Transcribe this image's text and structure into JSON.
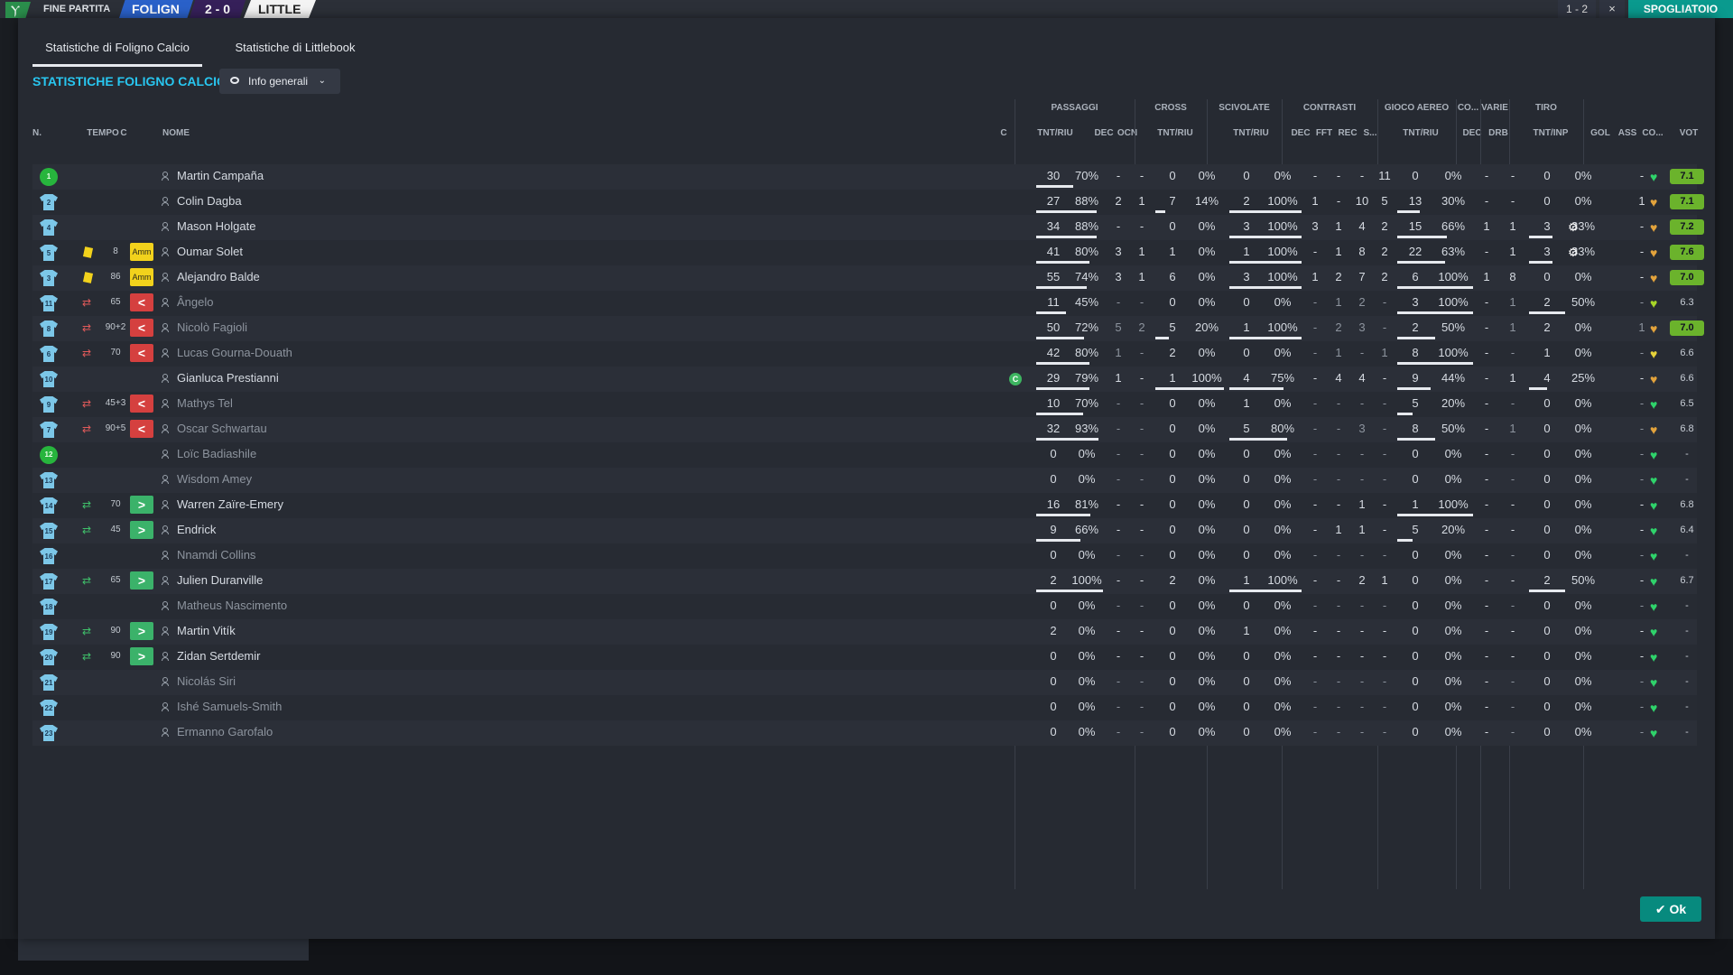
{
  "topbar": {
    "logo": "Ⲩ",
    "status": "FINE PARTITA",
    "home": "FOLIGN",
    "score": "2 - 0",
    "away": "LITTLE",
    "btn_score": "1 - 2",
    "btn_close": "×",
    "btn_right": "SPOGLIATOIO"
  },
  "tabs": [
    "Statistiche di Foligno Calcio",
    "Statistiche di Littlebook"
  ],
  "team_title": "STATISTICHE FOLIGNO CALCIO",
  "dropdown": "Info generali",
  "groups": {
    "passaggi": "PASSAGGI",
    "cross": "CROSS",
    "scivolate": "SCIVOLATE",
    "contrasti": "CONTRASTI",
    "aereo": "GIOCO AEREO",
    "co": "CO...",
    "varie": "VARIE",
    "tiro": "TIRO"
  },
  "headers": {
    "n": "N.",
    "tempo": "TEMPO",
    "c": "C",
    "nome": "NOME",
    "c2": "C",
    "pass_tr": "TNT/RIU",
    "pass_dec": "DEC",
    "pass_ocn": "OCN",
    "cross_tr": "TNT/RIU",
    "sciv_tr": "TNT/RIU",
    "con_dec": "DEC",
    "con_fft": "FFT",
    "con_rec": "REC",
    "con_s": "S...",
    "aer_tr": "TNT/RIU",
    "co_dec": "DEC",
    "var_drb": "DRB",
    "tiro_tr": "TNT/INP",
    "gol": "GOL",
    "ass": "ASS",
    "cond": "CO...",
    "vot": "VOT"
  },
  "colors": {
    "accent": "#28c6f0",
    "ok": "#078a7e",
    "heart_green": "#2fd36b",
    "heart_orange": "#e3a33c",
    "heart_lime": "#a8d628"
  },
  "players": [
    {
      "n": "1",
      "gk": true,
      "card": false,
      "swap": "",
      "min": "",
      "chip": "",
      "name": "Martin Campaña",
      "dim": false,
      "cap": false,
      "p": [
        "30",
        "70%",
        "-",
        "-"
      ],
      "cr": [
        "0",
        "0%"
      ],
      "sc": [
        "0",
        "0%"
      ],
      "ct": [
        "-",
        "-",
        "-",
        "11"
      ],
      "ae": [
        "0",
        "0%"
      ],
      "cd": "-",
      "drb": "-",
      "ti": [
        "0",
        "0%"
      ],
      "gol": "",
      "ass": "-",
      "heart": "green",
      "vot": "7.1",
      "vg": true,
      "bars": {
        "p": 0.55,
        "cr": 0,
        "sc": 0,
        "ae": 0,
        "ti": 0
      }
    },
    {
      "n": "2",
      "gk": false,
      "card": false,
      "swap": "",
      "min": "",
      "chip": "",
      "name": "Colin Dagba",
      "dim": false,
      "cap": false,
      "p": [
        "27",
        "88%",
        "2",
        "1"
      ],
      "cr": [
        "7",
        "14%"
      ],
      "sc": [
        "2",
        "100%"
      ],
      "ct": [
        "1",
        "-",
        "10",
        "5"
      ],
      "ae": [
        "13",
        "30%"
      ],
      "cd": "-",
      "drb": "-",
      "ti": [
        "0",
        "0%"
      ],
      "gol": "",
      "ass": "1",
      "heart": "orange",
      "vot": "7.1",
      "vg": true,
      "bars": {
        "p": 0.9,
        "cr": 0.15,
        "sc": 1,
        "ae": 0.3,
        "ti": 0
      }
    },
    {
      "n": "4",
      "gk": false,
      "card": false,
      "swap": "",
      "min": "",
      "chip": "",
      "name": "Mason Holgate",
      "dim": false,
      "cap": false,
      "p": [
        "34",
        "88%",
        "-",
        "-"
      ],
      "cr": [
        "0",
        "0%"
      ],
      "sc": [
        "3",
        "100%"
      ],
      "ct": [
        "3",
        "1",
        "4",
        "2"
      ],
      "ae": [
        "15",
        "66%"
      ],
      "cd": "1",
      "drb": "1",
      "ti": [
        "3",
        "33%"
      ],
      "gol": "⚙",
      "ass": "-",
      "heart": "orange",
      "vot": "7.2",
      "vg": true,
      "bars": {
        "p": 0.9,
        "cr": 0,
        "sc": 1,
        "ae": 0.66,
        "ti": 0.33
      }
    },
    {
      "n": "5",
      "gk": false,
      "card": true,
      "swap": "",
      "min": "8",
      "chip": "Amm",
      "name": "Oumar Solet",
      "dim": false,
      "cap": false,
      "p": [
        "41",
        "80%",
        "3",
        "1"
      ],
      "cr": [
        "1",
        "0%"
      ],
      "sc": [
        "1",
        "100%"
      ],
      "ct": [
        "-",
        "1",
        "8",
        "2"
      ],
      "ae": [
        "22",
        "63%"
      ],
      "cd": "-",
      "drb": "1",
      "ti": [
        "3",
        "33%"
      ],
      "gol": "⚙",
      "ass": "-",
      "heart": "orange",
      "vot": "7.6",
      "vg": true,
      "bars": {
        "p": 0.8,
        "cr": 0,
        "sc": 1,
        "ae": 0.63,
        "ti": 0.33
      }
    },
    {
      "n": "3",
      "gk": false,
      "card": true,
      "swap": "",
      "min": "86",
      "chip": "Amm",
      "name": "Alejandro Balde",
      "dim": false,
      "cap": false,
      "p": [
        "55",
        "74%",
        "3",
        "1"
      ],
      "cr": [
        "6",
        "0%"
      ],
      "sc": [
        "3",
        "100%"
      ],
      "ct": [
        "1",
        "2",
        "7",
        "2"
      ],
      "ae": [
        "6",
        "100%"
      ],
      "cd": "1",
      "drb": "8",
      "ti": [
        "0",
        "0%"
      ],
      "gol": "",
      "ass": "-",
      "heart": "orange",
      "vot": "7.0",
      "vg": true,
      "bars": {
        "p": 0.75,
        "cr": 0,
        "sc": 1,
        "ae": 1,
        "ti": 0
      }
    },
    {
      "n": "11",
      "gk": false,
      "card": false,
      "swap": "out",
      "min": "65",
      "chip": "<",
      "name": "Ângelo",
      "dim": true,
      "cap": false,
      "p": [
        "11",
        "45%",
        "-",
        "-"
      ],
      "cr": [
        "0",
        "0%"
      ],
      "sc": [
        "0",
        "0%"
      ],
      "ct": [
        "-",
        "1",
        "2",
        "-"
      ],
      "ae": [
        "3",
        "100%"
      ],
      "cd": "-",
      "drb": "1",
      "ti": [
        "2",
        "50%"
      ],
      "gol": "",
      "ass": "-",
      "heart": "lime",
      "vot": "6.3",
      "vg": false,
      "bars": {
        "p": 0.45,
        "cr": 0,
        "sc": 0,
        "ae": 1,
        "ti": 0.5
      }
    },
    {
      "n": "8",
      "gk": false,
      "card": false,
      "swap": "out",
      "min": "90+2",
      "chip": "<",
      "name": "Nicolò Fagioli",
      "dim": true,
      "cap": false,
      "p": [
        "50",
        "72%",
        "5",
        "2"
      ],
      "cr": [
        "5",
        "20%"
      ],
      "sc": [
        "1",
        "100%"
      ],
      "ct": [
        "-",
        "2",
        "3",
        "-"
      ],
      "ae": [
        "2",
        "50%"
      ],
      "cd": "-",
      "drb": "1",
      "ti": [
        "2",
        "0%"
      ],
      "gol": "",
      "ass": "1",
      "heart": "orange",
      "vot": "7.0",
      "vg": true,
      "bars": {
        "p": 0.72,
        "cr": 0.2,
        "sc": 1,
        "ae": 0.5,
        "ti": 0
      }
    },
    {
      "n": "6",
      "gk": false,
      "card": false,
      "swap": "out",
      "min": "70",
      "chip": "<",
      "name": "Lucas Gourna-Douath",
      "dim": true,
      "cap": false,
      "p": [
        "42",
        "80%",
        "1",
        "-"
      ],
      "cr": [
        "2",
        "0%"
      ],
      "sc": [
        "0",
        "0%"
      ],
      "ct": [
        "-",
        "1",
        "-",
        "1"
      ],
      "ae": [
        "8",
        "100%"
      ],
      "cd": "-",
      "drb": "-",
      "ti": [
        "1",
        "0%"
      ],
      "gol": "",
      "ass": "-",
      "heart": "yellow",
      "vot": "6.6",
      "vg": false,
      "bars": {
        "p": 0.8,
        "cr": 0,
        "sc": 0,
        "ae": 1,
        "ti": 0
      }
    },
    {
      "n": "10",
      "gk": false,
      "card": false,
      "swap": "",
      "min": "",
      "chip": "",
      "name": "Gianluca Prestianni",
      "dim": false,
      "cap": true,
      "p": [
        "29",
        "79%",
        "1",
        "-"
      ],
      "cr": [
        "1",
        "100%"
      ],
      "sc": [
        "4",
        "75%"
      ],
      "ct": [
        "-",
        "4",
        "4",
        "-"
      ],
      "ae": [
        "9",
        "44%"
      ],
      "cd": "-",
      "drb": "1",
      "ti": [
        "4",
        "25%"
      ],
      "gol": "",
      "ass": "-",
      "heart": "orange",
      "vot": "6.6",
      "vg": false,
      "bars": {
        "p": 0.8,
        "cr": 1,
        "sc": 0.75,
        "ae": 0.44,
        "ti": 0.25
      }
    },
    {
      "n": "9",
      "gk": false,
      "card": false,
      "swap": "out",
      "min": "45+3",
      "chip": "<",
      "name": "Mathys Tel",
      "dim": true,
      "cap": false,
      "p": [
        "10",
        "70%",
        "-",
        "-"
      ],
      "cr": [
        "0",
        "0%"
      ],
      "sc": [
        "1",
        "0%"
      ],
      "ct": [
        "-",
        "-",
        "-",
        "-"
      ],
      "ae": [
        "5",
        "20%"
      ],
      "cd": "-",
      "drb": "-",
      "ti": [
        "0",
        "0%"
      ],
      "gol": "",
      "ass": "-",
      "heart": "green",
      "vot": "6.5",
      "vg": false,
      "bars": {
        "p": 0.7,
        "cr": 0,
        "sc": 0,
        "ae": 0.2,
        "ti": 0
      }
    },
    {
      "n": "7",
      "gk": false,
      "card": false,
      "swap": "out",
      "min": "90+5",
      "chip": "<",
      "name": "Oscar Schwartau",
      "dim": true,
      "cap": false,
      "p": [
        "32",
        "93%",
        "-",
        "-"
      ],
      "cr": [
        "0",
        "0%"
      ],
      "sc": [
        "5",
        "80%"
      ],
      "ct": [
        "-",
        "-",
        "3",
        "-"
      ],
      "ae": [
        "8",
        "50%"
      ],
      "cd": "-",
      "drb": "1",
      "ti": [
        "0",
        "0%"
      ],
      "gol": "",
      "ass": "-",
      "heart": "orange",
      "vot": "6.8",
      "vg": false,
      "bars": {
        "p": 0.93,
        "cr": 0,
        "sc": 0.8,
        "ae": 0.5,
        "ti": 0
      }
    },
    {
      "n": "12",
      "gk": true,
      "card": false,
      "swap": "",
      "min": "",
      "chip": "",
      "name": "Loïc Badiashile",
      "dim": true,
      "cap": false,
      "p": [
        "0",
        "0%",
        "-",
        "-"
      ],
      "cr": [
        "0",
        "0%"
      ],
      "sc": [
        "0",
        "0%"
      ],
      "ct": [
        "-",
        "-",
        "-",
        "-"
      ],
      "ae": [
        "0",
        "0%"
      ],
      "cd": "-",
      "drb": "-",
      "ti": [
        "0",
        "0%"
      ],
      "gol": "",
      "ass": "-",
      "heart": "green",
      "vot": "-",
      "vg": false,
      "bars": {
        "p": 0,
        "cr": 0,
        "sc": 0,
        "ae": 0,
        "ti": 0
      }
    },
    {
      "n": "13",
      "gk": false,
      "card": false,
      "swap": "",
      "min": "",
      "chip": "",
      "name": "Wisdom Amey",
      "dim": true,
      "cap": false,
      "p": [
        "0",
        "0%",
        "-",
        "-"
      ],
      "cr": [
        "0",
        "0%"
      ],
      "sc": [
        "0",
        "0%"
      ],
      "ct": [
        "-",
        "-",
        "-",
        "-"
      ],
      "ae": [
        "0",
        "0%"
      ],
      "cd": "-",
      "drb": "-",
      "ti": [
        "0",
        "0%"
      ],
      "gol": "",
      "ass": "-",
      "heart": "green",
      "vot": "-",
      "vg": false,
      "bars": {
        "p": 0,
        "cr": 0,
        "sc": 0,
        "ae": 0,
        "ti": 0
      }
    },
    {
      "n": "14",
      "gk": false,
      "card": false,
      "swap": "in",
      "min": "70",
      "chip": ">",
      "name": "Warren Zaïre-Emery",
      "dim": false,
      "cap": false,
      "p": [
        "16",
        "81%",
        "-",
        "-"
      ],
      "cr": [
        "0",
        "0%"
      ],
      "sc": [
        "0",
        "0%"
      ],
      "ct": [
        "-",
        "-",
        "1",
        "-"
      ],
      "ae": [
        "1",
        "100%"
      ],
      "cd": "-",
      "drb": "-",
      "ti": [
        "0",
        "0%"
      ],
      "gol": "",
      "ass": "-",
      "heart": "green",
      "vot": "6.8",
      "vg": false,
      "bars": {
        "p": 0.81,
        "cr": 0,
        "sc": 0,
        "ae": 1,
        "ti": 0
      }
    },
    {
      "n": "15",
      "gk": false,
      "card": false,
      "swap": "in",
      "min": "45",
      "chip": ">",
      "name": "Endrick",
      "dim": false,
      "cap": false,
      "p": [
        "9",
        "66%",
        "-",
        "-"
      ],
      "cr": [
        "0",
        "0%"
      ],
      "sc": [
        "0",
        "0%"
      ],
      "ct": [
        "-",
        "1",
        "1",
        "-"
      ],
      "ae": [
        "5",
        "20%"
      ],
      "cd": "-",
      "drb": "-",
      "ti": [
        "0",
        "0%"
      ],
      "gol": "",
      "ass": "-",
      "heart": "green",
      "vot": "6.4",
      "vg": false,
      "bars": {
        "p": 0.66,
        "cr": 0,
        "sc": 0,
        "ae": 0.2,
        "ti": 0
      }
    },
    {
      "n": "16",
      "gk": false,
      "card": false,
      "swap": "",
      "min": "",
      "chip": "",
      "name": "Nnamdi Collins",
      "dim": true,
      "cap": false,
      "p": [
        "0",
        "0%",
        "-",
        "-"
      ],
      "cr": [
        "0",
        "0%"
      ],
      "sc": [
        "0",
        "0%"
      ],
      "ct": [
        "-",
        "-",
        "-",
        "-"
      ],
      "ae": [
        "0",
        "0%"
      ],
      "cd": "-",
      "drb": "-",
      "ti": [
        "0",
        "0%"
      ],
      "gol": "",
      "ass": "-",
      "heart": "green",
      "vot": "-",
      "vg": false,
      "bars": {
        "p": 0,
        "cr": 0,
        "sc": 0,
        "ae": 0,
        "ti": 0
      }
    },
    {
      "n": "17",
      "gk": false,
      "card": false,
      "swap": "in",
      "min": "65",
      "chip": ">",
      "name": "Julien Duranville",
      "dim": false,
      "cap": false,
      "p": [
        "2",
        "100%",
        "-",
        "-"
      ],
      "cr": [
        "2",
        "0%"
      ],
      "sc": [
        "1",
        "100%"
      ],
      "ct": [
        "-",
        "-",
        "2",
        "1"
      ],
      "ae": [
        "0",
        "0%"
      ],
      "cd": "-",
      "drb": "-",
      "ti": [
        "2",
        "50%"
      ],
      "gol": "",
      "ass": "-",
      "heart": "green",
      "vot": "6.7",
      "vg": false,
      "bars": {
        "p": 1,
        "cr": 0,
        "sc": 1,
        "ae": 0,
        "ti": 0.5
      }
    },
    {
      "n": "18",
      "gk": false,
      "card": false,
      "swap": "",
      "min": "",
      "chip": "",
      "name": "Matheus Nascimento",
      "dim": true,
      "cap": false,
      "p": [
        "0",
        "0%",
        "-",
        "-"
      ],
      "cr": [
        "0",
        "0%"
      ],
      "sc": [
        "0",
        "0%"
      ],
      "ct": [
        "-",
        "-",
        "-",
        "-"
      ],
      "ae": [
        "0",
        "0%"
      ],
      "cd": "-",
      "drb": "-",
      "ti": [
        "0",
        "0%"
      ],
      "gol": "",
      "ass": "-",
      "heart": "green",
      "vot": "-",
      "vg": false,
      "bars": {
        "p": 0,
        "cr": 0,
        "sc": 0,
        "ae": 0,
        "ti": 0
      }
    },
    {
      "n": "19",
      "gk": false,
      "card": false,
      "swap": "in",
      "min": "90",
      "chip": ">",
      "name": "Martin Vitík",
      "dim": false,
      "cap": false,
      "p": [
        "2",
        "0%",
        "-",
        "-"
      ],
      "cr": [
        "0",
        "0%"
      ],
      "sc": [
        "1",
        "0%"
      ],
      "ct": [
        "-",
        "-",
        "-",
        "-"
      ],
      "ae": [
        "0",
        "0%"
      ],
      "cd": "-",
      "drb": "-",
      "ti": [
        "0",
        "0%"
      ],
      "gol": "",
      "ass": "-",
      "heart": "green",
      "vot": "-",
      "vg": false,
      "bars": {
        "p": 0,
        "cr": 0,
        "sc": 0,
        "ae": 0,
        "ti": 0
      }
    },
    {
      "n": "20",
      "gk": false,
      "card": false,
      "swap": "in",
      "min": "90",
      "chip": ">",
      "name": "Zidan Sertdemir",
      "dim": false,
      "cap": false,
      "p": [
        "0",
        "0%",
        "-",
        "-"
      ],
      "cr": [
        "0",
        "0%"
      ],
      "sc": [
        "0",
        "0%"
      ],
      "ct": [
        "-",
        "-",
        "-",
        "-"
      ],
      "ae": [
        "0",
        "0%"
      ],
      "cd": "-",
      "drb": "-",
      "ti": [
        "0",
        "0%"
      ],
      "gol": "",
      "ass": "-",
      "heart": "green",
      "vot": "-",
      "vg": false,
      "bars": {
        "p": 0,
        "cr": 0,
        "sc": 0,
        "ae": 0,
        "ti": 0
      }
    },
    {
      "n": "21",
      "gk": false,
      "card": false,
      "swap": "",
      "min": "",
      "chip": "",
      "name": "Nicolás Siri",
      "dim": true,
      "cap": false,
      "p": [
        "0",
        "0%",
        "-",
        "-"
      ],
      "cr": [
        "0",
        "0%"
      ],
      "sc": [
        "0",
        "0%"
      ],
      "ct": [
        "-",
        "-",
        "-",
        "-"
      ],
      "ae": [
        "0",
        "0%"
      ],
      "cd": "-",
      "drb": "-",
      "ti": [
        "0",
        "0%"
      ],
      "gol": "",
      "ass": "-",
      "heart": "green",
      "vot": "-",
      "vg": false,
      "bars": {
        "p": 0,
        "cr": 0,
        "sc": 0,
        "ae": 0,
        "ti": 0
      }
    },
    {
      "n": "22",
      "gk": false,
      "card": false,
      "swap": "",
      "min": "",
      "chip": "",
      "name": "Ishé Samuels-Smith",
      "dim": true,
      "cap": false,
      "p": [
        "0",
        "0%",
        "-",
        "-"
      ],
      "cr": [
        "0",
        "0%"
      ],
      "sc": [
        "0",
        "0%"
      ],
      "ct": [
        "-",
        "-",
        "-",
        "-"
      ],
      "ae": [
        "0",
        "0%"
      ],
      "cd": "-",
      "drb": "-",
      "ti": [
        "0",
        "0%"
      ],
      "gol": "",
      "ass": "-",
      "heart": "green",
      "vot": "-",
      "vg": false,
      "bars": {
        "p": 0,
        "cr": 0,
        "sc": 0,
        "ae": 0,
        "ti": 0
      }
    },
    {
      "n": "23",
      "gk": false,
      "card": false,
      "swap": "",
      "min": "",
      "chip": "",
      "name": "Ermanno Garofalo",
      "dim": true,
      "cap": false,
      "p": [
        "0",
        "0%",
        "-",
        "-"
      ],
      "cr": [
        "0",
        "0%"
      ],
      "sc": [
        "0",
        "0%"
      ],
      "ct": [
        "-",
        "-",
        "-",
        "-"
      ],
      "ae": [
        "0",
        "0%"
      ],
      "cd": "-",
      "drb": "-",
      "ti": [
        "0",
        "0%"
      ],
      "gol": "",
      "ass": "-",
      "heart": "green",
      "vot": "-",
      "vg": false,
      "bars": {
        "p": 0,
        "cr": 0,
        "sc": 0,
        "ae": 0,
        "ti": 0
      }
    }
  ],
  "ok_label": "Ok",
  "ok_icon": "✔",
  "person_icon": "person-icon",
  "heart_icon": "♥",
  "captain": "C",
  "swap_icon": "⇄",
  "eye_icon": "eye-icon",
  "chev_icon": "⌄"
}
